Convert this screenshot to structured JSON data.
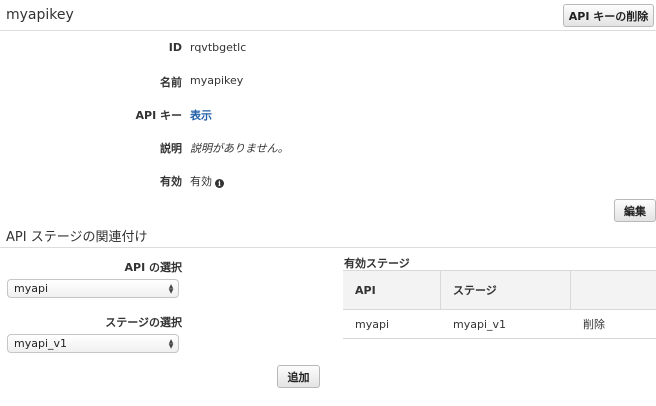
{
  "header": {
    "title": "myapikey",
    "delete_button": "API キーの削除"
  },
  "details": {
    "id_label": "ID",
    "id_value": "rqvtbgetlc",
    "name_label": "名前",
    "name_value": "myapikey",
    "apikey_label": "API キー",
    "apikey_value": "表示",
    "description_label": "説明",
    "description_value": "説明がありません。",
    "enabled_label": "有効",
    "enabled_value": "有効",
    "info_icon": "i"
  },
  "edit_button": "編集",
  "stage_section": {
    "title": "API ステージの関連付け",
    "api_select_label": "API の選択",
    "api_select_value": "myapi",
    "stage_select_label": "ステージの選択",
    "stage_select_value": "myapi_v1",
    "add_button": "追加",
    "active_stages_label": "有効ステージ",
    "table": {
      "headers": [
        "API",
        "ステージ",
        ""
      ],
      "rows": [
        {
          "api": "myapi",
          "stage": "myapi_v1",
          "action": "削除"
        }
      ]
    }
  }
}
